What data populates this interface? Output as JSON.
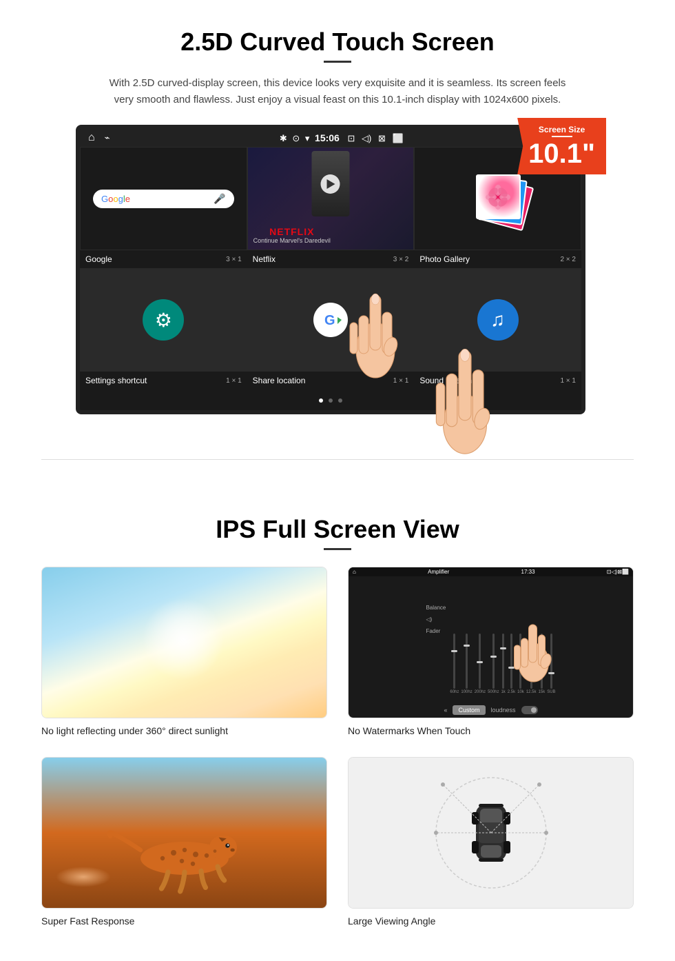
{
  "section1": {
    "title": "2.5D Curved Touch Screen",
    "description": "With 2.5D curved-display screen, this device looks very exquisite and it is seamless. Its screen feels very smooth and flawless. Just enjoy a visual feast on this 10.1-inch display with 1024x600 pixels.",
    "badge": {
      "label": "Screen Size",
      "size": "10.1\""
    },
    "statusBar": {
      "bluetooth": "✱",
      "location": "⊙",
      "wifi": "▾",
      "time": "15:06",
      "camera": "⊡",
      "volume": "◁)",
      "close": "⊠",
      "window": "⬜"
    },
    "apps": [
      {
        "name": "Google",
        "size": "3 × 1"
      },
      {
        "name": "Netflix",
        "size": "3 × 2"
      },
      {
        "name": "Photo Gallery",
        "size": "2 × 2"
      },
      {
        "name": "Settings shortcut",
        "size": "1 × 1"
      },
      {
        "name": "Share location",
        "size": "1 × 1"
      },
      {
        "name": "Sound Search",
        "size": "1 × 1"
      }
    ],
    "netflix": {
      "logo": "NETFLIX",
      "subtitle": "Continue Marvel's Daredevil"
    }
  },
  "section2": {
    "title": "IPS Full Screen View",
    "items": [
      {
        "label": "No light reflecting under 360° direct sunlight",
        "type": "sunlight"
      },
      {
        "label": "No Watermarks When Touch",
        "type": "amplifier"
      },
      {
        "label": "Super Fast Response",
        "type": "cheetah"
      },
      {
        "label": "Large Viewing Angle",
        "type": "car"
      }
    ]
  }
}
